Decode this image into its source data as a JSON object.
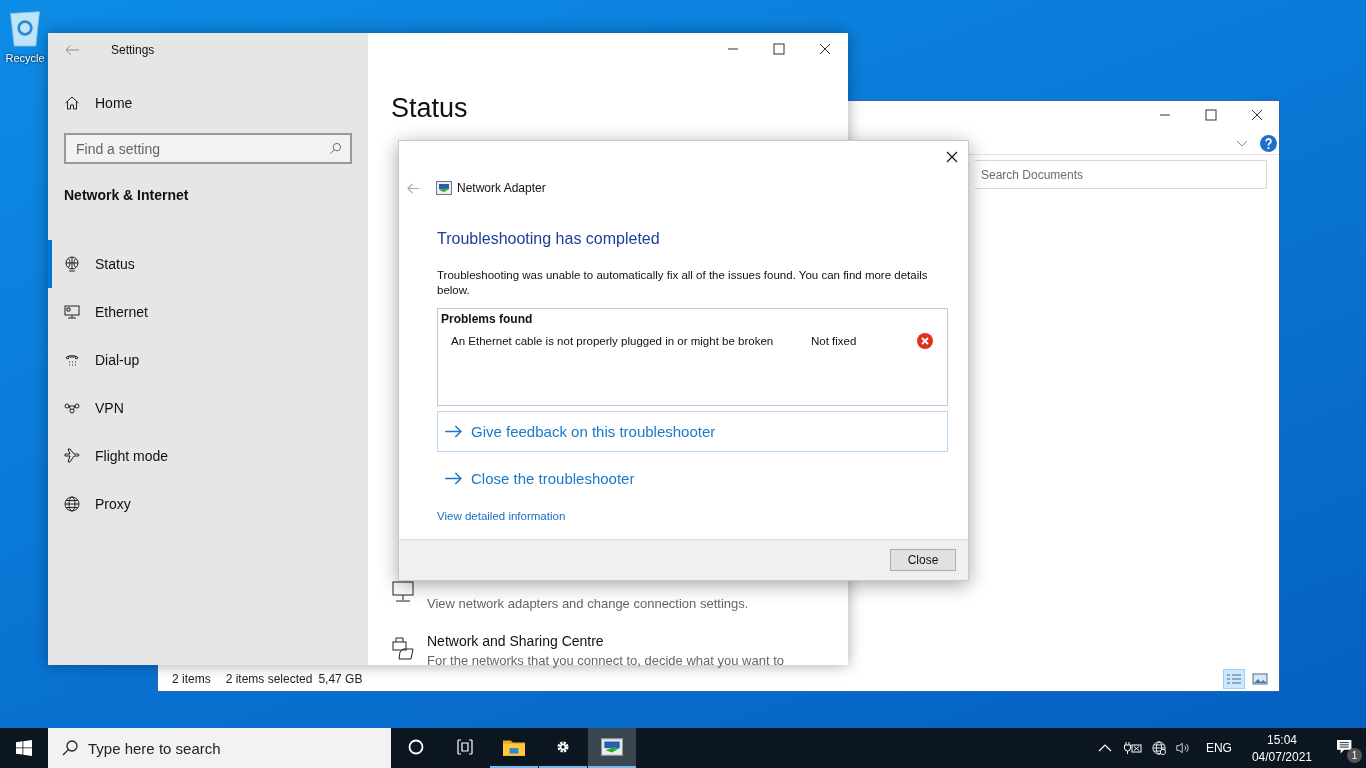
{
  "desktop": {
    "icons": [
      {
        "label": "Recycle"
      }
    ]
  },
  "explorer": {
    "search": {
      "placeholder": "Search Documents"
    },
    "status_bar": {
      "item_count": "2 items",
      "selection": "2 items selected",
      "size": "5,47 GB"
    },
    "views": [
      {
        "kind": "details",
        "selected": true
      },
      {
        "kind": "preview",
        "selected": false
      }
    ]
  },
  "settings": {
    "title": "Settings",
    "home": "Home",
    "search": {
      "placeholder": "Find a setting"
    },
    "section": "Network & Internet",
    "nav": [
      {
        "label": "Status",
        "selected": true
      },
      {
        "label": "Ethernet",
        "selected": false
      },
      {
        "label": "Dial-up",
        "selected": false
      },
      {
        "label": "VPN",
        "selected": false
      },
      {
        "label": "Flight mode",
        "selected": false
      },
      {
        "label": "Proxy",
        "selected": false
      }
    ],
    "page": {
      "title": "Status",
      "items": [
        {
          "description": "View network adapters and change connection settings."
        },
        {
          "title": "Network and Sharing Centre",
          "description": "For the networks that you connect to, decide what you want to"
        }
      ]
    }
  },
  "dialog": {
    "title": "Network Adapter",
    "heading": "Troubleshooting has completed",
    "message": "Troubleshooting was unable to automatically fix all of the issues found. You can find more details below.",
    "problems": {
      "header": "Problems found",
      "rows": [
        {
          "description": "An Ethernet cable is not properly plugged in or might be broken",
          "status": "Not fixed",
          "kind": "error"
        }
      ]
    },
    "links": [
      {
        "label": "Give feedback on this troubleshooter",
        "focused": true
      },
      {
        "label": "Close the troubleshooter",
        "focused": false
      }
    ],
    "detail_link": "View detailed information",
    "buttons": [
      "Close"
    ]
  },
  "taskbar": {
    "search": {
      "placeholder": "Type here to search"
    },
    "apps": [
      {
        "kind": "cortana",
        "running": false,
        "selected": false
      },
      {
        "kind": "task-view",
        "running": false,
        "selected": false
      },
      {
        "kind": "explorer",
        "running": true,
        "selected": false
      },
      {
        "kind": "settings",
        "running": true,
        "selected": false
      },
      {
        "kind": "troubleshooter",
        "running": true,
        "selected": true
      }
    ],
    "tray": {
      "language": "ENG",
      "time": "15:04",
      "date": "04/07/2021",
      "notifications": "1"
    }
  }
}
